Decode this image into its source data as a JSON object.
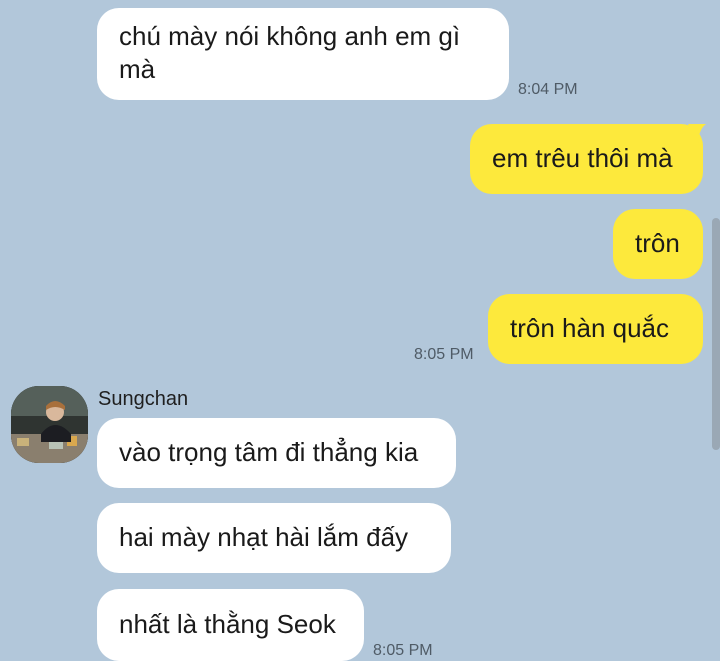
{
  "messages": {
    "m1": {
      "text": "chú mày nói không anh em gì mà",
      "time": "8:04 PM"
    },
    "m2": {
      "text": "em trêu thôi mà"
    },
    "m3": {
      "text": "trôn"
    },
    "m4": {
      "text": "trôn hàn quắc",
      "time": "8:05 PM"
    },
    "sender_name": "Sungchan",
    "m5": {
      "text": "vào trọng tâm đi thẳng kia"
    },
    "m6": {
      "text": "hai mày nhạt hài lắm đấy"
    },
    "m7": {
      "text": "nhất là thằng Seok",
      "time": "8:05 PM"
    }
  },
  "colors": {
    "background": "#b2c7da",
    "incoming_bubble": "#ffffff",
    "outgoing_bubble": "#fde93c"
  },
  "icons": {
    "avatar": "contact-avatar-photo"
  }
}
